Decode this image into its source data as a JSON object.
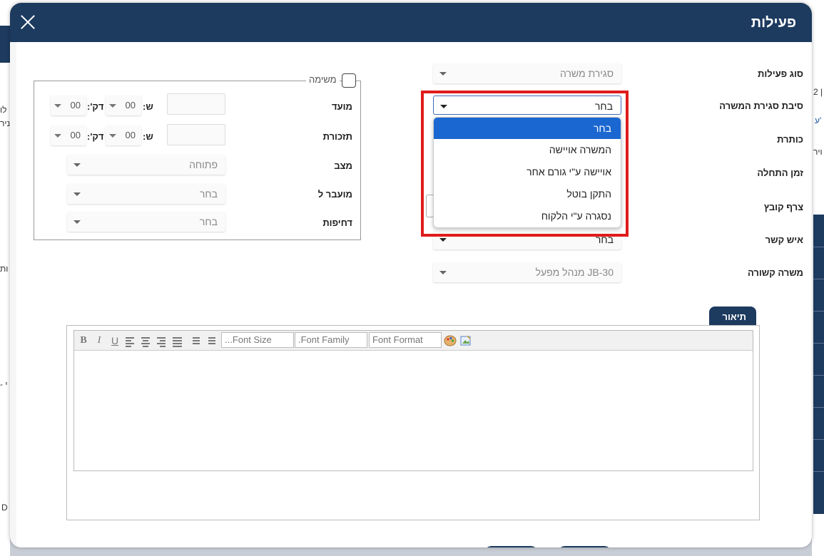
{
  "modal": {
    "title": "פעילות"
  },
  "form": {
    "activity_type": {
      "label": "סוג פעילות",
      "value": "סגירת משרה"
    },
    "close_reason": {
      "label": "סיבת סגירת המשרה",
      "value": "בחר"
    },
    "title_label": "כותרת",
    "start_time_label": "זמן התחלה",
    "attach_file_label": "צרף קובץ",
    "contact": {
      "label": "איש קשר",
      "value": "בחר"
    },
    "related_job": {
      "label": "משרה קשורה",
      "value": "JB-30 מנהל מפעל"
    }
  },
  "dropdown": {
    "options": [
      "בחר",
      "המשרה אויישה",
      "אויישה ע\"י גורם אחר",
      "התקן בוטל",
      "נסגרה ע\"י הלקוח"
    ],
    "selected_index": 0
  },
  "task": {
    "legend": "משימה",
    "due": {
      "label": "מועד",
      "hours_label": "ש:",
      "minutes_label": "דק':",
      "hours": "00",
      "minutes": "00"
    },
    "reminder": {
      "label": "תזכורת",
      "hours_label": "ש:",
      "minutes_label": "דק':",
      "hours": "00",
      "minutes": "00"
    },
    "status": {
      "label": "מצב",
      "value": "פתוחה"
    },
    "transferred_to": {
      "label": "מועבר ל",
      "value": "בחר"
    },
    "priority": {
      "label": "דחיפות",
      "value": "בחר"
    }
  },
  "description": {
    "tab_label": "תיאור",
    "toolbar": {
      "bold": "B",
      "italic": "I",
      "underline": "U",
      "font_size_placeholder": "...Font Size",
      "font_family_placeholder": ".Font Family",
      "font_format_placeholder": "Font Format"
    }
  },
  "background": {
    "fragments": [
      "לו",
      "ניר",
      "2 |",
      "ע'",
      "ויר",
      "ות",
      "- י",
      "D"
    ]
  },
  "colors": {
    "header": "#1d3a5f",
    "highlight": "#e01b1b",
    "selected_option": "#1b67d1"
  }
}
